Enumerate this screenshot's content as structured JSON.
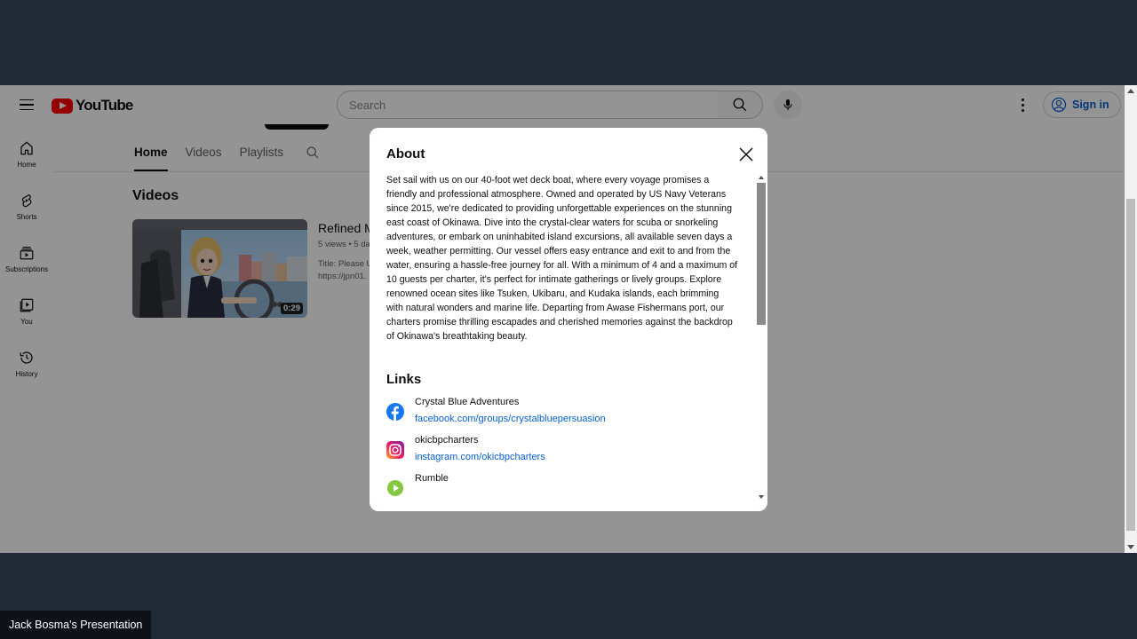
{
  "header": {
    "logo_text": "YouTube",
    "search_placeholder": "Search",
    "signin_label": "Sign in"
  },
  "sidebar": {
    "items": [
      {
        "label": "Home"
      },
      {
        "label": "Shorts"
      },
      {
        "label": "Subscriptions"
      },
      {
        "label": "You"
      },
      {
        "label": "History"
      }
    ]
  },
  "channel": {
    "tabs": [
      "Home",
      "Videos",
      "Playlists"
    ],
    "active_tab": "Home",
    "section_title": "Videos",
    "video": {
      "title": "Refined M",
      "meta": "5 views • 5 da",
      "desc_line1": "Title: Please U",
      "desc_line2": "https://jpn01.",
      "duration": "0:29"
    }
  },
  "about_dialog": {
    "title": "About",
    "description": "Set sail with us on our 40-foot wet deck boat, where every voyage promises a friendly and professional atmosphere. Owned and operated by US Navy Veterans since 2015, we're dedicated to providing unforgettable experiences on the stunning east coast of Okinawa. Dive into the crystal-clear waters for scuba or snorkeling adventures, or embark on uninhabited island excursions, all available seven days a week, weather permitting. Our vessel offers easy entrance and exit to and from the water, ensuring a hassle-free journey for all. With a minimum of 4 and a maximum of 10 guests per charter, it's perfect for intimate gatherings or lively groups. Explore renowned ocean sites like Tsuken, Ukibaru, and Kudaka islands, each brimming with natural wonders and marine life. Departing from Awase Fishermans port, our charters promise thrilling escapades and cherished memories against the backdrop of Okinawa's breathtaking beauty.",
    "links_title": "Links",
    "links": [
      {
        "name": "Crystal Blue Adventures",
        "url": "facebook.com/groups/crystalbluepersuasion",
        "icon": "facebook-icon"
      },
      {
        "name": "okicbpcharters",
        "url": "instagram.com/okicbpcharters",
        "icon": "instagram-icon"
      },
      {
        "name": "Rumble",
        "url": "",
        "icon": "rumble-icon"
      }
    ]
  },
  "presenter_label": "Jack Bosma's Presentation",
  "colors": {
    "youtube_red": "#ff0000",
    "link_blue": "#065fd4",
    "facebook_blue": "#1877f2",
    "desktop_bg": "#212936"
  }
}
